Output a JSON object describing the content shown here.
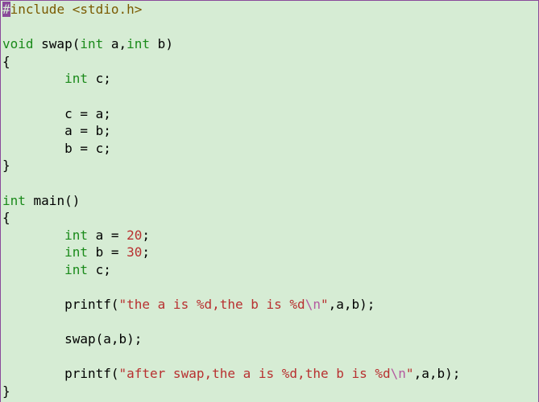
{
  "code": {
    "line1": {
      "hash": "#",
      "include": "include",
      "header": " <stdio.h>"
    },
    "line3": {
      "void": "void",
      "swap": " swap(",
      "int1": "int",
      "a": " a,",
      "int2": "int",
      "b": " b)"
    },
    "brace_open1": "{",
    "line5": {
      "indent": "        ",
      "int": "int",
      "rest": " c;"
    },
    "line7": {
      "indent": "        ",
      "text": "c = a;"
    },
    "line8": {
      "indent": "        ",
      "text": "a = b;"
    },
    "line9": {
      "indent": "        ",
      "text": "b = c;"
    },
    "brace_close1": "}",
    "line12": {
      "int": "int",
      "main": " main()"
    },
    "brace_open2": "{",
    "line14": {
      "indent": "        ",
      "int": "int",
      "mid": " a = ",
      "num": "20",
      "semi": ";"
    },
    "line15": {
      "indent": "        ",
      "int": "int",
      "mid": " b = ",
      "num": "30",
      "semi": ";"
    },
    "line16": {
      "indent": "        ",
      "int": "int",
      "rest": " c;"
    },
    "line18": {
      "indent": "        ",
      "printf": "printf(",
      "s1": "\"the a is %d,the b is %d",
      "esc": "\\n",
      "s2": "\"",
      "args": ",a,b);"
    },
    "line20": {
      "indent": "        ",
      "text": "swap(a,b);"
    },
    "line22": {
      "indent": "        ",
      "printf": "printf(",
      "s1": "\"after swap,the a is %d,the b is %d",
      "esc": "\\n",
      "s2": "\"",
      "args": ",a,b);"
    },
    "brace_close2": "}"
  }
}
